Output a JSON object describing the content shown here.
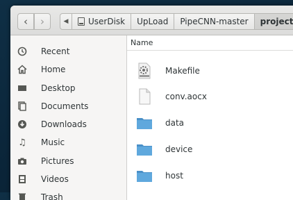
{
  "navigation": {
    "back_icon": "chevron-left-icon",
    "forward_icon": "chevron-right-icon",
    "scroll_icon": "triangle-left-icon"
  },
  "breadcrumb": [
    {
      "label": "UserDisk",
      "icon": "drive-icon"
    },
    {
      "label": "UpLoad"
    },
    {
      "label": "PipeCNN-master"
    },
    {
      "label": "project",
      "active": true
    }
  ],
  "sidebar": {
    "items": [
      {
        "label": "Recent",
        "icon": "clock-icon"
      },
      {
        "label": "Home",
        "icon": "home-icon"
      },
      {
        "label": "Desktop",
        "icon": "desktop-icon"
      },
      {
        "label": "Documents",
        "icon": "documents-icon"
      },
      {
        "label": "Downloads",
        "icon": "download-icon"
      },
      {
        "label": "Music",
        "icon": "music-icon"
      },
      {
        "label": "Pictures",
        "icon": "camera-icon"
      },
      {
        "label": "Videos",
        "icon": "film-icon"
      },
      {
        "label": "Trash",
        "icon": "trash-icon"
      }
    ]
  },
  "file_list": {
    "column_name": "Name",
    "files": [
      {
        "name": "Makefile",
        "type": "makefile"
      },
      {
        "name": "conv.aocx",
        "type": "document"
      },
      {
        "name": "data",
        "type": "folder"
      },
      {
        "name": "device",
        "type": "folder"
      },
      {
        "name": "host",
        "type": "folder"
      }
    ]
  },
  "colors": {
    "folder": "#5fa8dd",
    "folder_tab": "#4a90c8",
    "accent_bg": "#0f2f45"
  }
}
